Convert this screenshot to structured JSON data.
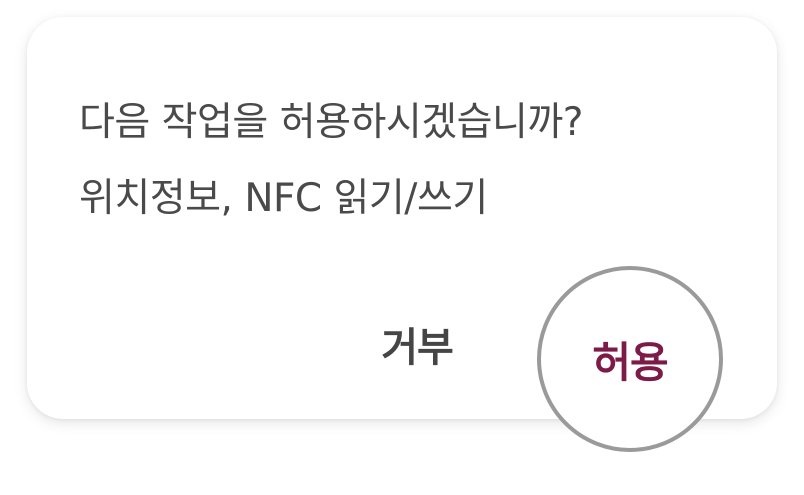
{
  "dialog": {
    "message_line1": "다음 작업을 허용하시겠습니까?",
    "message_line2": "위치정보, NFC 읽기/쓰기",
    "deny_label": "거부",
    "allow_label": "허용"
  },
  "colors": {
    "message_text": "#4a4a4a",
    "deny_text": "#454545",
    "allow_text": "#7d1b48",
    "highlight_ring": "#9a9a9a",
    "dialog_background": "#ffffff"
  }
}
